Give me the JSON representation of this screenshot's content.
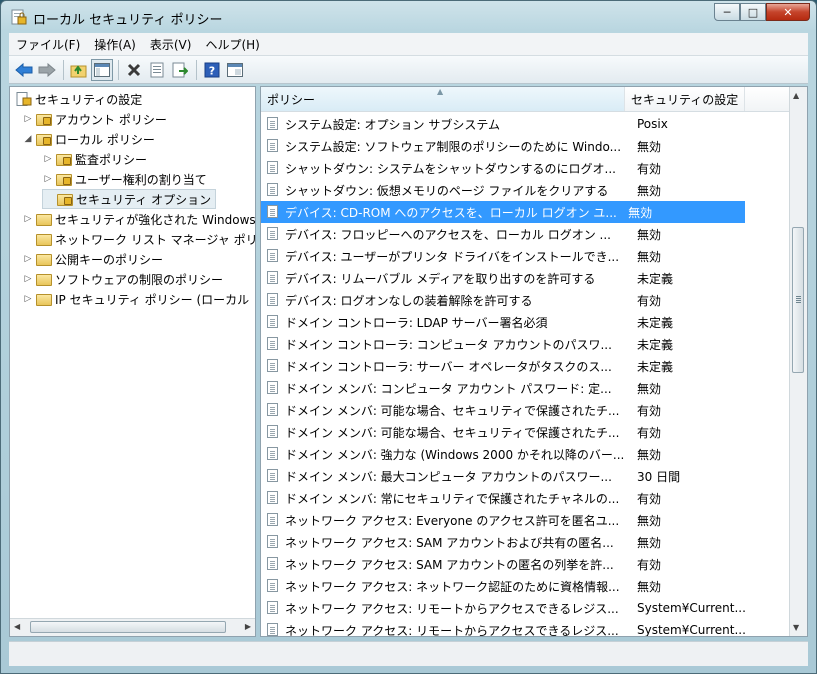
{
  "window": {
    "title": "ローカル セキュリティ ポリシー",
    "min": "─",
    "max": "□",
    "close": "✕"
  },
  "menu": [
    {
      "label": "ファイル(F)"
    },
    {
      "label": "操作(A)"
    },
    {
      "label": "表示(V)"
    },
    {
      "label": "ヘルプ(H)"
    }
  ],
  "tree": {
    "root": "セキュリティの設定",
    "items": [
      {
        "label": "アカウント ポリシー",
        "arrow": "▷",
        "level": 1,
        "lock": true
      },
      {
        "label": "ローカル ポリシー",
        "arrow": "◢",
        "level": 1,
        "lock": true
      },
      {
        "label": "監査ポリシー",
        "arrow": "▷",
        "level": 2,
        "lock": true
      },
      {
        "label": "ユーザー権利の割り当て",
        "arrow": "▷",
        "level": 2,
        "lock": true
      },
      {
        "label": "セキュリティ オプション",
        "arrow": "",
        "level": 2,
        "lock": true,
        "selected": true
      },
      {
        "label": "セキュリティが強化された Windows",
        "arrow": "▷",
        "level": 1,
        "lock": false
      },
      {
        "label": "ネットワーク リスト マネージャ ポリ",
        "arrow": "",
        "level": 1,
        "lock": false
      },
      {
        "label": "公開キーのポリシー",
        "arrow": "▷",
        "level": 1,
        "lock": false
      },
      {
        "label": "ソフトウェアの制限のポリシー",
        "arrow": "▷",
        "level": 1,
        "lock": false
      },
      {
        "label": "IP セキュリティ ポリシー (ローカル",
        "arrow": "▷",
        "level": 1,
        "lock": false
      }
    ]
  },
  "list": {
    "columns": {
      "policy": "ポリシー",
      "setting": "セキュリティの設定"
    },
    "selected_index": 4,
    "rows": [
      {
        "policy": "システム設定: オプション サブシステム",
        "setting": "Posix"
      },
      {
        "policy": "システム設定: ソフトウェア制限のポリシーのために Windo...",
        "setting": "無効"
      },
      {
        "policy": "シャットダウン: システムをシャットダウンするのにログオ...",
        "setting": "有効"
      },
      {
        "policy": "シャットダウン: 仮想メモリのページ ファイルをクリアする",
        "setting": "無効"
      },
      {
        "policy": "デバイス: CD-ROM へのアクセスを、ローカル ログオン ユ...",
        "setting": "無効"
      },
      {
        "policy": "デバイス: フロッピーへのアクセスを、ローカル ログオン ...",
        "setting": "無効"
      },
      {
        "policy": "デバイス: ユーザーがプリンタ ドライバをインストールでき...",
        "setting": "無効"
      },
      {
        "policy": "デバイス: リムーバブル メディアを取り出すのを許可する",
        "setting": "未定義"
      },
      {
        "policy": "デバイス: ログオンなしの装着解除を許可する",
        "setting": "有効"
      },
      {
        "policy": "ドメイン コントローラ: LDAP サーバー署名必須",
        "setting": "未定義"
      },
      {
        "policy": "ドメイン コントローラ: コンピュータ アカウントのパスワ...",
        "setting": "未定義"
      },
      {
        "policy": "ドメイン コントローラ: サーバー オペレータがタスクのス...",
        "setting": "未定義"
      },
      {
        "policy": "ドメイン メンバ: コンピュータ アカウント パスワード: 定...",
        "setting": "無効"
      },
      {
        "policy": "ドメイン メンバ: 可能な場合、セキュリティで保護されたチ...",
        "setting": "有効"
      },
      {
        "policy": "ドメイン メンバ: 可能な場合、セキュリティで保護されたチ...",
        "setting": "有効"
      },
      {
        "policy": "ドメイン メンバ: 強力な (Windows 2000 かそれ以降のバー...",
        "setting": "無効"
      },
      {
        "policy": "ドメイン メンバ: 最大コンピュータ アカウントのパスワー...",
        "setting": "30 日間"
      },
      {
        "policy": "ドメイン メンバ: 常にセキュリティで保護されたチャネルの...",
        "setting": "有効"
      },
      {
        "policy": "ネットワーク アクセス: Everyone のアクセス許可を匿名ユ...",
        "setting": "無効"
      },
      {
        "policy": "ネットワーク アクセス: SAM アカウントおよび共有の匿名...",
        "setting": "無効"
      },
      {
        "policy": "ネットワーク アクセス: SAM アカウントの匿名の列挙を許...",
        "setting": "有効"
      },
      {
        "policy": "ネットワーク アクセス: ネットワーク認証のために資格情報...",
        "setting": "無効"
      },
      {
        "policy": "ネットワーク アクセス: リモートからアクセスできるレジス...",
        "setting": "System¥Current..."
      },
      {
        "policy": "ネットワーク アクセス: リモートからアクセスできるレジス...",
        "setting": "System¥Current..."
      }
    ]
  },
  "colors": {
    "selection": "#3399ff",
    "header_active": "#d9ecf6"
  }
}
